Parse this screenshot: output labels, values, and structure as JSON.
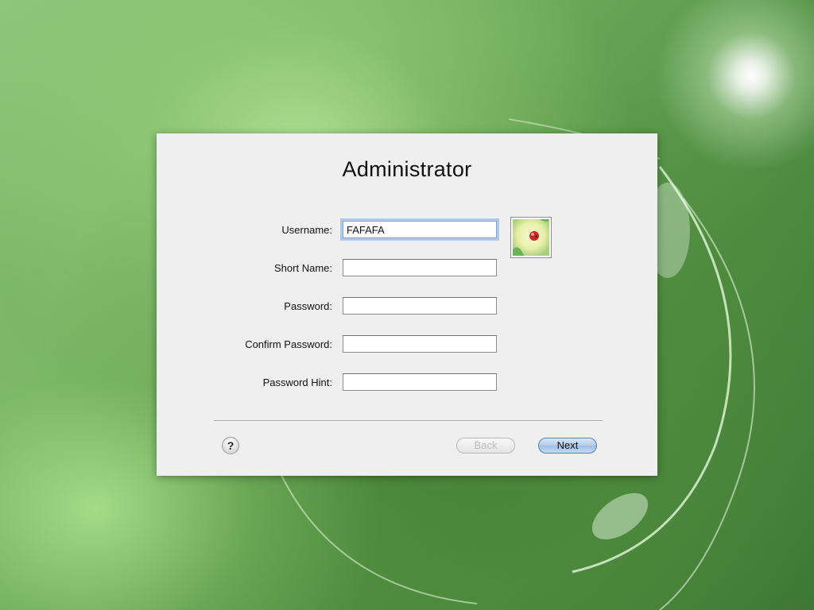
{
  "dialog": {
    "title": "Administrator"
  },
  "form": {
    "username": {
      "label": "Username:",
      "value": "FAFAFA"
    },
    "short_name": {
      "label": "Short Name:",
      "value": ""
    },
    "password": {
      "label": "Password:",
      "value": ""
    },
    "confirm_password": {
      "label": "Confirm Password:",
      "value": ""
    },
    "password_hint": {
      "label": "Password Hint:",
      "value": ""
    }
  },
  "footer": {
    "help_label": "?",
    "back_label": "Back",
    "next_label": "Next"
  },
  "colors": {
    "dialog_background": "#efefef",
    "focus_ring": "#7ea5d6",
    "next_button": "#b3cbe8"
  }
}
